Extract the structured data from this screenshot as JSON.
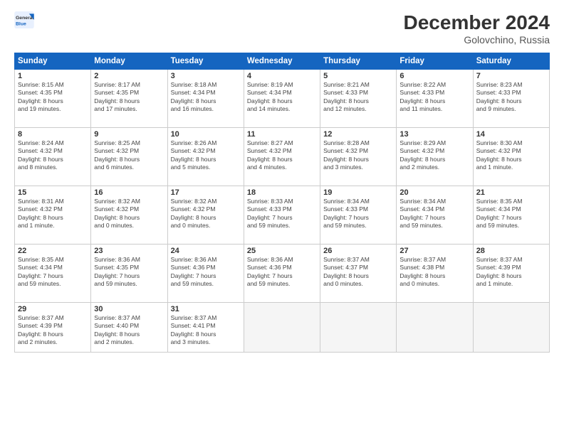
{
  "header": {
    "logo_line1": "General",
    "logo_line2": "Blue",
    "month": "December 2024",
    "location": "Golovchino, Russia"
  },
  "weekdays": [
    "Sunday",
    "Monday",
    "Tuesday",
    "Wednesday",
    "Thursday",
    "Friday",
    "Saturday"
  ],
  "weeks": [
    [
      {
        "day": "1",
        "info": "Sunrise: 8:15 AM\nSunset: 4:35 PM\nDaylight: 8 hours\nand 19 minutes."
      },
      {
        "day": "2",
        "info": "Sunrise: 8:17 AM\nSunset: 4:35 PM\nDaylight: 8 hours\nand 17 minutes."
      },
      {
        "day": "3",
        "info": "Sunrise: 8:18 AM\nSunset: 4:34 PM\nDaylight: 8 hours\nand 16 minutes."
      },
      {
        "day": "4",
        "info": "Sunrise: 8:19 AM\nSunset: 4:34 PM\nDaylight: 8 hours\nand 14 minutes."
      },
      {
        "day": "5",
        "info": "Sunrise: 8:21 AM\nSunset: 4:33 PM\nDaylight: 8 hours\nand 12 minutes."
      },
      {
        "day": "6",
        "info": "Sunrise: 8:22 AM\nSunset: 4:33 PM\nDaylight: 8 hours\nand 11 minutes."
      },
      {
        "day": "7",
        "info": "Sunrise: 8:23 AM\nSunset: 4:33 PM\nDaylight: 8 hours\nand 9 minutes."
      }
    ],
    [
      {
        "day": "8",
        "info": "Sunrise: 8:24 AM\nSunset: 4:32 PM\nDaylight: 8 hours\nand 8 minutes."
      },
      {
        "day": "9",
        "info": "Sunrise: 8:25 AM\nSunset: 4:32 PM\nDaylight: 8 hours\nand 6 minutes."
      },
      {
        "day": "10",
        "info": "Sunrise: 8:26 AM\nSunset: 4:32 PM\nDaylight: 8 hours\nand 5 minutes."
      },
      {
        "day": "11",
        "info": "Sunrise: 8:27 AM\nSunset: 4:32 PM\nDaylight: 8 hours\nand 4 minutes."
      },
      {
        "day": "12",
        "info": "Sunrise: 8:28 AM\nSunset: 4:32 PM\nDaylight: 8 hours\nand 3 minutes."
      },
      {
        "day": "13",
        "info": "Sunrise: 8:29 AM\nSunset: 4:32 PM\nDaylight: 8 hours\nand 2 minutes."
      },
      {
        "day": "14",
        "info": "Sunrise: 8:30 AM\nSunset: 4:32 PM\nDaylight: 8 hours\nand 1 minute."
      }
    ],
    [
      {
        "day": "15",
        "info": "Sunrise: 8:31 AM\nSunset: 4:32 PM\nDaylight: 8 hours\nand 1 minute."
      },
      {
        "day": "16",
        "info": "Sunrise: 8:32 AM\nSunset: 4:32 PM\nDaylight: 8 hours\nand 0 minutes."
      },
      {
        "day": "17",
        "info": "Sunrise: 8:32 AM\nSunset: 4:32 PM\nDaylight: 8 hours\nand 0 minutes."
      },
      {
        "day": "18",
        "info": "Sunrise: 8:33 AM\nSunset: 4:33 PM\nDaylight: 7 hours\nand 59 minutes."
      },
      {
        "day": "19",
        "info": "Sunrise: 8:34 AM\nSunset: 4:33 PM\nDaylight: 7 hours\nand 59 minutes."
      },
      {
        "day": "20",
        "info": "Sunrise: 8:34 AM\nSunset: 4:34 PM\nDaylight: 7 hours\nand 59 minutes."
      },
      {
        "day": "21",
        "info": "Sunrise: 8:35 AM\nSunset: 4:34 PM\nDaylight: 7 hours\nand 59 minutes."
      }
    ],
    [
      {
        "day": "22",
        "info": "Sunrise: 8:35 AM\nSunset: 4:34 PM\nDaylight: 7 hours\nand 59 minutes."
      },
      {
        "day": "23",
        "info": "Sunrise: 8:36 AM\nSunset: 4:35 PM\nDaylight: 7 hours\nand 59 minutes."
      },
      {
        "day": "24",
        "info": "Sunrise: 8:36 AM\nSunset: 4:36 PM\nDaylight: 7 hours\nand 59 minutes."
      },
      {
        "day": "25",
        "info": "Sunrise: 8:36 AM\nSunset: 4:36 PM\nDaylight: 7 hours\nand 59 minutes."
      },
      {
        "day": "26",
        "info": "Sunrise: 8:37 AM\nSunset: 4:37 PM\nDaylight: 8 hours\nand 0 minutes."
      },
      {
        "day": "27",
        "info": "Sunrise: 8:37 AM\nSunset: 4:38 PM\nDaylight: 8 hours\nand 0 minutes."
      },
      {
        "day": "28",
        "info": "Sunrise: 8:37 AM\nSunset: 4:39 PM\nDaylight: 8 hours\nand 1 minute."
      }
    ],
    [
      {
        "day": "29",
        "info": "Sunrise: 8:37 AM\nSunset: 4:39 PM\nDaylight: 8 hours\nand 2 minutes."
      },
      {
        "day": "30",
        "info": "Sunrise: 8:37 AM\nSunset: 4:40 PM\nDaylight: 8 hours\nand 2 minutes."
      },
      {
        "day": "31",
        "info": "Sunrise: 8:37 AM\nSunset: 4:41 PM\nDaylight: 8 hours\nand 3 minutes."
      },
      null,
      null,
      null,
      null
    ]
  ]
}
